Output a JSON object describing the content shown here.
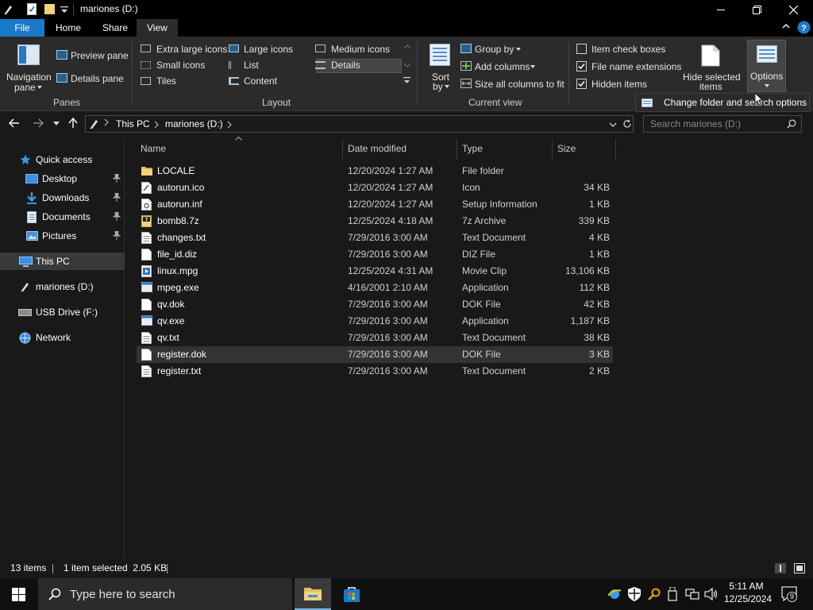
{
  "window": {
    "title": "mariones (D:)"
  },
  "ribbon_tabs": [
    "File",
    "Home",
    "Share",
    "View"
  ],
  "ribbon": {
    "panes": {
      "navigation_pane": "Navigation",
      "navigation_pane_2": "pane",
      "preview_pane": "Preview pane",
      "details_pane": "Details pane",
      "group_label": "Panes"
    },
    "layout": {
      "extra_large_icons": "Extra large icons",
      "large_icons": "Large icons",
      "medium_icons": "Medium icons",
      "small_icons": "Small icons",
      "list": "List",
      "details": "Details",
      "tiles": "Tiles",
      "content": "Content",
      "group_label": "Layout"
    },
    "current_view": {
      "sort_by": "Sort",
      "sort_by_2": "by",
      "group_by": "Group by",
      "add_columns": "Add columns",
      "size_all_columns": "Size all columns to fit",
      "group_label": "Current view"
    },
    "show_hide": {
      "item_check_boxes": "Item check boxes",
      "file_name_extensions": "File name extensions",
      "hidden_items": "Hidden items",
      "hide_selected_items": "Hide selected",
      "hide_selected_items_2": "items",
      "options": "Options",
      "checked_item_check_boxes": false,
      "checked_file_name_extensions": true,
      "checked_hidden_items": true
    }
  },
  "tooltip": {
    "text": "Change folder and search options"
  },
  "address": {
    "crumbs": [
      "This PC",
      "mariones (D:)"
    ],
    "search_placeholder": "Search mariones (D:)"
  },
  "nav": {
    "items": [
      {
        "label": "Quick access"
      },
      {
        "label": "Desktop"
      },
      {
        "label": "Downloads"
      },
      {
        "label": "Documents"
      },
      {
        "label": "Pictures"
      },
      {
        "label": "This PC"
      },
      {
        "label": "mariones (D:)"
      },
      {
        "label": "USB Drive (F:)"
      },
      {
        "label": "Network"
      }
    ]
  },
  "columns": {
    "name": "Name",
    "date_modified": "Date modified",
    "type": "Type",
    "size": "Size"
  },
  "files": [
    {
      "name": "LOCALE",
      "date": "12/20/2024 1:27 AM",
      "type": "File folder",
      "size": "",
      "icon": "folder-icon"
    },
    {
      "name": "autorun.ico",
      "date": "12/20/2024 1:27 AM",
      "type": "Icon",
      "size": "34 KB",
      "icon": "icon-file-icon"
    },
    {
      "name": "autorun.inf",
      "date": "12/20/2024 1:27 AM",
      "type": "Setup Information",
      "size": "1 KB",
      "icon": "setup-file-icon"
    },
    {
      "name": "bomb8.7z",
      "date": "12/25/2024 4:18 AM",
      "type": "7z Archive",
      "size": "339 KB",
      "icon": "archive-file-icon"
    },
    {
      "name": "changes.txt",
      "date": "7/29/2016 3:00 AM",
      "type": "Text Document",
      "size": "4 KB",
      "icon": "text-file-icon"
    },
    {
      "name": "file_id.diz",
      "date": "7/29/2016 3:00 AM",
      "type": "DIZ File",
      "size": "1 KB",
      "icon": "generic-file-icon"
    },
    {
      "name": "linux.mpg",
      "date": "12/25/2024 4:31 AM",
      "type": "Movie Clip",
      "size": "13,106 KB",
      "icon": "movie-file-icon"
    },
    {
      "name": "mpeg.exe",
      "date": "4/16/2001 2:10 AM",
      "type": "Application",
      "size": "112 KB",
      "icon": "application-icon"
    },
    {
      "name": "qv.dok",
      "date": "7/29/2016 3:00 AM",
      "type": "DOK File",
      "size": "42 KB",
      "icon": "generic-file-icon"
    },
    {
      "name": "qv.exe",
      "date": "7/29/2016 3:00 AM",
      "type": "Application",
      "size": "1,187 KB",
      "icon": "application-icon"
    },
    {
      "name": "qv.txt",
      "date": "7/29/2016 3:00 AM",
      "type": "Text Document",
      "size": "38 KB",
      "icon": "text-file-icon"
    },
    {
      "name": "register.dok",
      "date": "7/29/2016 3:00 AM",
      "type": "DOK File",
      "size": "3 KB",
      "icon": "generic-file-icon",
      "selected": true
    },
    {
      "name": "register.txt",
      "date": "7/29/2016 3:00 AM",
      "type": "Text Document",
      "size": "2 KB",
      "icon": "text-file-icon"
    }
  ],
  "status": {
    "item_count": "13 items",
    "selection": "1 item selected  2.05 KB"
  },
  "taskbar": {
    "search_placeholder": "Type here to search",
    "time": "5:11 AM",
    "date": "12/25/2024",
    "notification_count": "9"
  },
  "colors": {
    "accent": "#1979ca",
    "background": "#191919",
    "ribbon": "#2b2b2b",
    "folder": "#e8c158"
  }
}
